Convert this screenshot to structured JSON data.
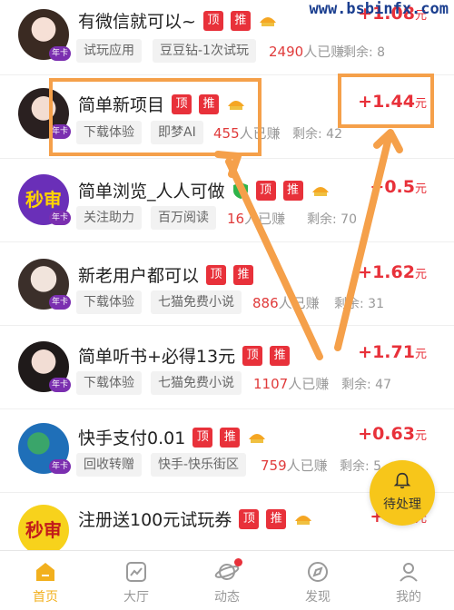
{
  "watermark": "www.bsbinfx.com",
  "items": [
    {
      "title": "有微信就可以~",
      "tags": [
        "顶",
        "推"
      ],
      "chip1": "试玩应用",
      "chip2": "豆豆钻-1次试玩",
      "earned_num": "2490",
      "earned_suffix": "人已赚",
      "remain": "剩余: 8",
      "price": "+1.08",
      "unit": "元",
      "vip": "年卡"
    },
    {
      "title": "简单新项目",
      "tags": [
        "顶",
        "推"
      ],
      "chip1": "下载体验",
      "chip2": "即梦AI",
      "earned_num": "455",
      "earned_suffix": "人已赚",
      "remain": "剩余: 42",
      "price": "+1.44",
      "unit": "元",
      "vip": "年卡"
    },
    {
      "title": "简单浏览_人人可做",
      "tags": [
        "顶",
        "推"
      ],
      "chip1": "关注助力",
      "chip2": "百万阅读",
      "earned_num": "16",
      "earned_suffix": "人已赚",
      "remain": "剩余: 70",
      "price": "+0.5",
      "unit": "元",
      "vip": "年卡",
      "avatar_text": "秒审"
    },
    {
      "title": "新老用户都可以",
      "tags": [
        "顶",
        "推"
      ],
      "chip1": "下载体验",
      "chip2": "七猫免费小说",
      "earned_num": "886",
      "earned_suffix": "人已赚",
      "remain": "剩余: 31",
      "price": "+1.62",
      "unit": "元",
      "vip": "年卡"
    },
    {
      "title": "简单听书+必得13元",
      "tags": [
        "顶",
        "推"
      ],
      "chip1": "下载体验",
      "chip2": "七猫免费小说",
      "earned_num": "1107",
      "earned_suffix": "人已赚",
      "remain": "剩余: 47",
      "price": "+1.71",
      "unit": "元",
      "vip": "年卡"
    },
    {
      "title": "快手支付0.01",
      "tags": [
        "顶",
        "推"
      ],
      "chip1": "回收转赠",
      "chip2": "快手-快乐街区",
      "earned_num": "759",
      "earned_suffix": "人已赚",
      "remain": "剩余: 5",
      "price": "+0.63",
      "unit": "元",
      "vip": "年卡"
    },
    {
      "title": "注册送100元试玩券",
      "tags": [
        "顶",
        "推"
      ],
      "price": "+0.7",
      "unit": "元",
      "avatar_text": "秒审"
    }
  ],
  "fab": {
    "label": "待处理"
  },
  "nav": [
    {
      "label": "首页"
    },
    {
      "label": "大厅"
    },
    {
      "label": "动态"
    },
    {
      "label": "发现"
    },
    {
      "label": "我的"
    }
  ],
  "colors": {
    "accent": "#f2b01e",
    "price": "#e8313a",
    "highlight": "#f5a04a"
  }
}
